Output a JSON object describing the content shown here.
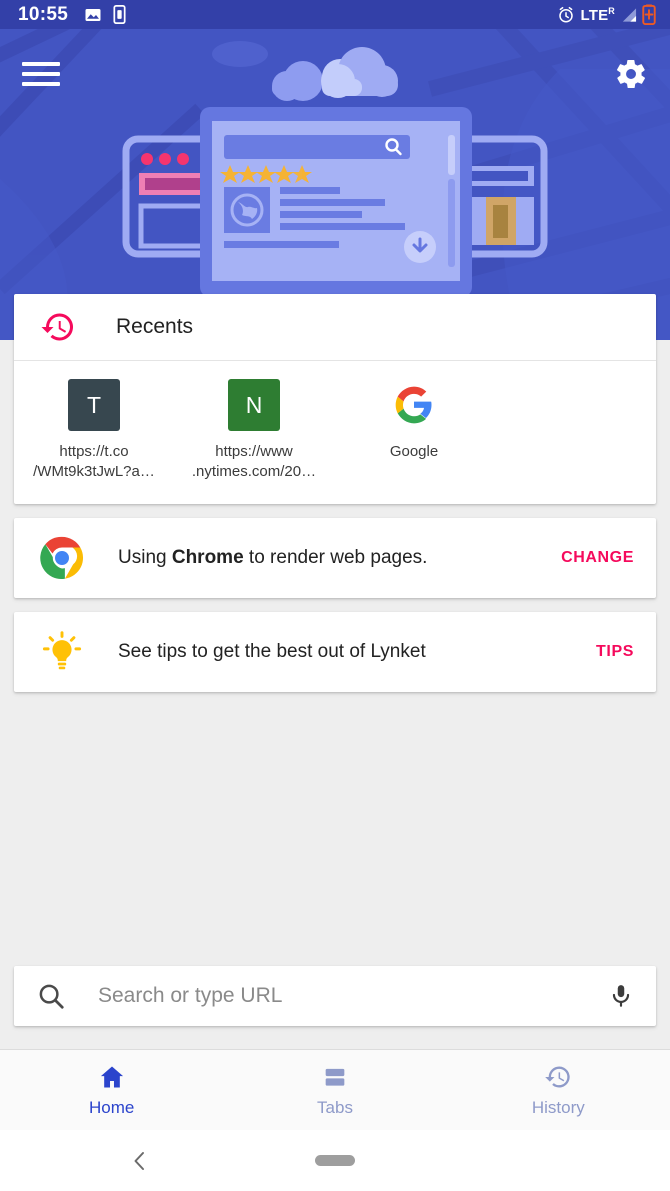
{
  "statusbar": {
    "time": "10:55",
    "network_label": "LTE",
    "network_roaming": "R",
    "icons": [
      "image-icon",
      "sim-icon",
      "alarm-icon",
      "signal-icon",
      "battery-charging-icon"
    ]
  },
  "header": {
    "menu_icon": "hamburger-menu-icon",
    "settings_icon": "gear-icon"
  },
  "recents": {
    "title": "Recents",
    "icon": "history-icon",
    "items": [
      {
        "initial": "T",
        "label": "https://t.co\n/WMt9k3tJwL?a…",
        "tile_color": "#37474f",
        "icon_type": "letter"
      },
      {
        "initial": "N",
        "label": "https://www\n.nytimes.com/20…",
        "tile_color": "#2e7d32",
        "icon_type": "letter"
      },
      {
        "initial": "G",
        "label": "Google",
        "tile_color": "#ffffff",
        "icon_type": "google-logo"
      }
    ]
  },
  "browser_card": {
    "icon": "chrome-icon",
    "text_prefix": "Using ",
    "browser_name": "Chrome",
    "text_suffix": " to render web pages.",
    "action_label": "CHANGE"
  },
  "tips_card": {
    "icon": "lightbulb-icon",
    "text": "See tips to get the best out of Lynket",
    "action_label": "TIPS"
  },
  "search": {
    "placeholder": "Search or type URL",
    "search_icon": "search-icon",
    "mic_icon": "microphone-icon"
  },
  "bottom_nav": {
    "items": [
      {
        "label": "Home",
        "icon": "home-icon",
        "active": true
      },
      {
        "label": "Tabs",
        "icon": "tabs-icon",
        "active": false
      },
      {
        "label": "History",
        "icon": "history-icon",
        "active": false
      }
    ]
  },
  "android_nav": {
    "back_icon": "back-chevron-icon",
    "home_icon": "home-pill-icon"
  },
  "colors": {
    "hero_bg": "#4355c2",
    "statusbar_bg": "#3340a8",
    "accent_pink": "#f50a5c",
    "page_bg": "#eeeeee",
    "nav_active": "#2b44cc",
    "nav_inactive": "#8e9ac9"
  }
}
